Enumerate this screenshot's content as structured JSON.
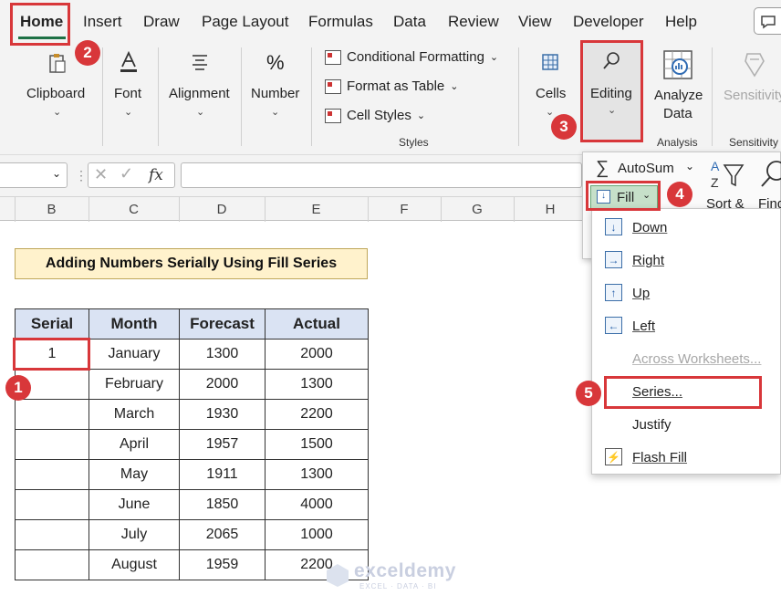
{
  "menu": {
    "tabs": [
      "Home",
      "Insert",
      "Draw",
      "Page Layout",
      "Formulas",
      "Data",
      "Review",
      "View",
      "Developer",
      "Help"
    ]
  },
  "ribbon": {
    "clipboard": "Clipboard",
    "font": "Font",
    "alignment": "Alignment",
    "number": "Number",
    "conditional_formatting": "Conditional Formatting",
    "format_as_table": "Format as Table",
    "cell_styles": "Cell Styles",
    "styles_group": "Styles",
    "cells": "Cells",
    "editing": "Editing",
    "analyze_line1": "Analyze",
    "analyze_line2": "Data",
    "analysis_group": "Analysis",
    "sensitivity": "Sensitivity",
    "sensitivity_group": "Sensitivity",
    "number_symbol": "%"
  },
  "formula_bar": {
    "fx": "fx"
  },
  "columns": [
    "B",
    "C",
    "D",
    "E",
    "F",
    "G",
    "H"
  ],
  "sheet": {
    "title": "Adding Numbers Serially Using Fill Series",
    "headers": [
      "Serial",
      "Month",
      "Forecast",
      "Actual"
    ],
    "rows": [
      [
        "1",
        "January",
        "1300",
        "2000"
      ],
      [
        "",
        "February",
        "2000",
        "1300"
      ],
      [
        "",
        "March",
        "1930",
        "2200"
      ],
      [
        "",
        "April",
        "1957",
        "1500"
      ],
      [
        "",
        "May",
        "1911",
        "1300"
      ],
      [
        "",
        "June",
        "1850",
        "4000"
      ],
      [
        "",
        "July",
        "2065",
        "1000"
      ],
      [
        "",
        "August",
        "1959",
        "2200"
      ]
    ]
  },
  "editing_panel": {
    "autosum": "AutoSum",
    "fill": "Fill",
    "sort_filter": "Sort &",
    "find": "Find"
  },
  "fill_menu": {
    "items": [
      "Down",
      "Right",
      "Up",
      "Left",
      "Across Worksheets...",
      "Series...",
      "Justify",
      "Flash Fill"
    ]
  },
  "badges": [
    "1",
    "2",
    "3",
    "4",
    "5"
  ],
  "watermark": {
    "name": "exceldemy",
    "tagline": "EXCEL · DATA · BI"
  },
  "colors": {
    "accent_green": "#1e7145",
    "highlight_red": "#d8373a",
    "header_fill": "#dae3f3",
    "title_fill": "#fff2cc"
  }
}
